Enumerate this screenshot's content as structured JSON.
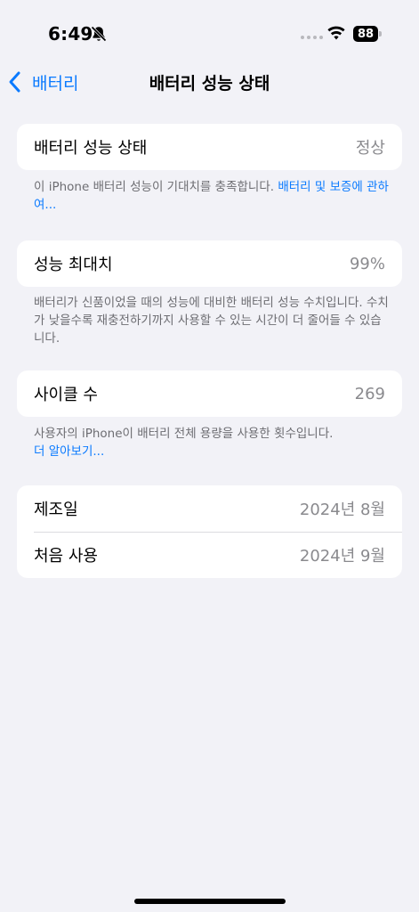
{
  "status_bar": {
    "time": "6:49",
    "battery_level": "88",
    "icons": [
      "bell-slash-icon",
      "signal-dots-icon",
      "wifi-icon",
      "battery-icon"
    ]
  },
  "nav": {
    "back_label": "배터리",
    "title": "배터리 성능 상태"
  },
  "health_group": {
    "label": "배터리 성능 상태",
    "value": "정상",
    "footnote_text": "이 iPhone 배터리 성능이 기대치를 충족합니다. ",
    "footnote_link": "배터리 및 보증에 관하여..."
  },
  "capacity_group": {
    "label": "성능 최대치",
    "value": "99%",
    "footnote_text": "배터리가 신품이었을 때의 성능에 대비한 배터리 성능 수치입니다. 수치가 낮을수록 재충전하기까지 사용할 수 있는 시간이 더 줄어들 수 있습니다."
  },
  "cycle_group": {
    "label": "사이클 수",
    "value": "269",
    "footnote_text": "사용자의 iPhone이 배터리 전체 용량을 사용한 횟수입니다.",
    "footnote_link": "더 알아보기..."
  },
  "dates_group": {
    "rows": [
      {
        "label": "제조일",
        "value": "2024년 8월"
      },
      {
        "label": "처음 사용",
        "value": "2024년 9월"
      }
    ]
  },
  "colors": {
    "accent": "#0a7aff",
    "background": "#f2f2f7",
    "secondary_text": "#8a8a8e"
  }
}
